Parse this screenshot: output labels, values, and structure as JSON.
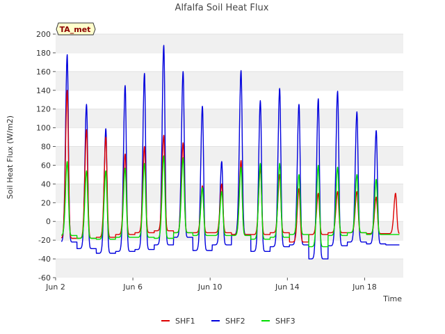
{
  "chart_data": {
    "type": "line",
    "title": "Alfalfa Soil Heat Flux",
    "xlabel": "Time",
    "ylabel": "Soil Heat Flux (W/m2)",
    "badge": "TA_met",
    "x_tick_labels": [
      "Jun 2",
      "Jun 6",
      "Jun 10",
      "Jun 14",
      "Jun 18"
    ],
    "x_tick_days": [
      2,
      6,
      10,
      14,
      18
    ],
    "xlim": [
      2,
      20
    ],
    "ylim": [
      -60,
      200
    ],
    "y_ticks": [
      -60,
      -40,
      -20,
      0,
      20,
      40,
      60,
      80,
      100,
      120,
      140,
      160,
      180,
      200
    ],
    "grid": "horizontal bands",
    "legend_position": "bottom-center",
    "x_unit": "day of June",
    "daily_peaks": {
      "days": [
        2.6,
        3.6,
        4.6,
        5.6,
        6.6,
        7.6,
        8.6,
        9.6,
        10.6,
        11.6,
        12.6,
        13.6,
        14.6,
        15.6,
        16.6,
        17.6,
        18.6,
        19.6
      ],
      "SHF1": [
        140,
        98,
        90,
        72,
        80,
        92,
        84,
        38,
        40,
        65,
        57,
        50,
        35,
        30,
        32,
        32,
        26,
        30
      ],
      "SHF2": [
        178,
        125,
        99,
        145,
        158,
        188,
        160,
        123,
        64,
        161,
        129,
        142,
        125,
        131,
        139,
        117,
        97,
        0
      ],
      "SHF3": [
        64,
        54,
        54,
        57,
        62,
        70,
        68,
        36,
        32,
        58,
        62,
        62,
        50,
        60,
        58,
        50,
        45,
        0
      ],
      "SHF1_min": [
        -18,
        -18,
        -17,
        -14,
        -12,
        -10,
        -12,
        -12,
        -12,
        -14,
        -14,
        -12,
        -22,
        -14,
        -12,
        -12,
        -13,
        -13
      ],
      "SHF2_min": [
        -22,
        -29,
        -34,
        -32,
        -30,
        -25,
        -17,
        -31,
        -25,
        -14,
        -32,
        -27,
        -25,
        -40,
        -26,
        -22,
        -24,
        -25
      ],
      "SHF3_min": [
        -15,
        -18,
        -19,
        -17,
        -17,
        -18,
        -12,
        -15,
        -15,
        -15,
        -19,
        -17,
        -14,
        -27,
        -15,
        -12,
        -14,
        -14
      ]
    },
    "series": [
      {
        "name": "SHF1",
        "color": "#dd0000"
      },
      {
        "name": "SHF2",
        "color": "#0000dd"
      },
      {
        "name": "SHF3",
        "color": "#00dd00"
      }
    ]
  }
}
